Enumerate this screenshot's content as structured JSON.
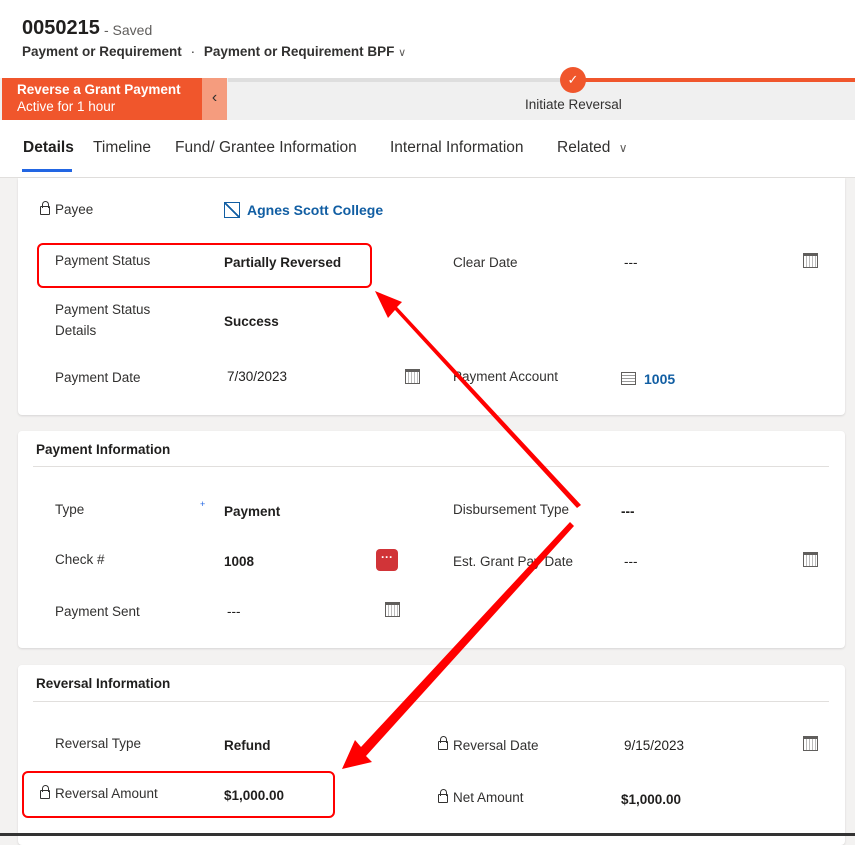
{
  "header": {
    "record_id": "0050215",
    "save_status": "- Saved",
    "entity": "Payment or Requirement",
    "separator": "·",
    "form": "Payment or Requirement BPF"
  },
  "bpf": {
    "process_name": "Reverse a Grant Payment",
    "active_for": "Active for 1 hour",
    "stage": "Initiate Reversal",
    "collapse_icon": "chevron-left",
    "stage_status": "completed",
    "accent": "#f0562c"
  },
  "tabs": [
    {
      "label": "Details"
    },
    {
      "label": "Timeline"
    },
    {
      "label": "Fund/ Grantee Information"
    },
    {
      "label": "Internal Information"
    },
    {
      "label": "Related"
    }
  ],
  "general": {
    "payee": {
      "label": "Payee",
      "value": "Agnes Scott College"
    },
    "payment_status": {
      "label": "Payment Status",
      "value": "Partially Reversed"
    },
    "clear_date": {
      "label": "Clear Date",
      "value": "---"
    },
    "payment_status_details": {
      "label1": "Payment Status",
      "label2": "Details",
      "value": "Success"
    },
    "payment_date": {
      "label": "Payment Date",
      "value": "7/30/2023"
    },
    "payment_account": {
      "label": "Payment Account",
      "value": "1005"
    }
  },
  "payment_info": {
    "title": "Payment Information",
    "type": {
      "label": "Type",
      "required_marker": "+",
      "value": "Payment"
    },
    "disbursement_type": {
      "label": "Disbursement Type",
      "value": "---"
    },
    "check": {
      "label": "Check #",
      "value": "1008",
      "more_icon": "···"
    },
    "est_grant_pay_date": {
      "label": "Est. Grant Pay Date",
      "value": "---"
    },
    "payment_sent": {
      "label": "Payment Sent",
      "value": "---"
    }
  },
  "reversal_info": {
    "title": "Reversal Information",
    "reversal_type": {
      "label": "Reversal Type",
      "value": "Refund"
    },
    "reversal_date": {
      "label": "Reversal Date",
      "value": "9/15/2023"
    },
    "reversal_amount": {
      "label": "Reversal Amount",
      "value": "$1,000.00"
    },
    "net_amount": {
      "label": "Net Amount",
      "value": "$1,000.00"
    }
  },
  "annotation_color": "#ff0000"
}
